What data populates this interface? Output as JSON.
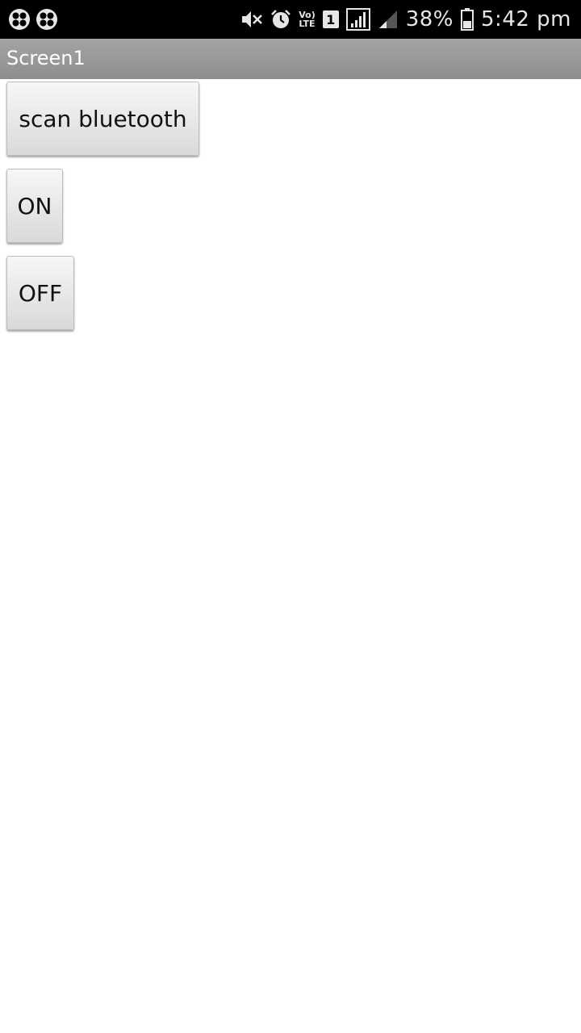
{
  "status_bar": {
    "battery": "38%",
    "time": "5:42 pm",
    "volte": "Vo)",
    "lte": "LTE",
    "sim": "1",
    "icons": [
      "app-notification-icon",
      "app-notification-icon",
      "mute-icon",
      "alarm-icon",
      "volte-icon",
      "sim-icon",
      "signal-icon",
      "signal-icon",
      "battery-icon"
    ]
  },
  "app_bar": {
    "title": "Screen1"
  },
  "buttons": {
    "scan": "scan bluetooth",
    "on": "ON",
    "off": "OFF"
  },
  "colors": {
    "status_bar_bg": "#000000",
    "title_bar_bg": "#999999",
    "button_bg": "#e6e6e6"
  }
}
